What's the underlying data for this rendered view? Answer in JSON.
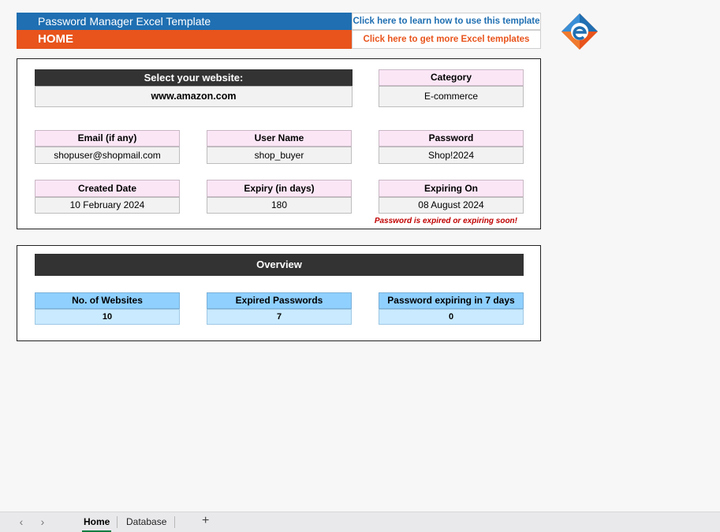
{
  "header": {
    "title": "Password Manager Excel Template",
    "subtitle": "HOME",
    "learn_link": "Click here to learn how to use this template",
    "more_link": "Click here to get more Excel templates"
  },
  "colors": {
    "brand_blue": "#1f6fb2",
    "brand_orange": "#e8541c",
    "warning_red": "#c00000"
  },
  "selection": {
    "select_label": "Select your website:",
    "website": "www.amazon.com",
    "category_label": "Category",
    "category_value": "E-commerce"
  },
  "credentials": {
    "email_label": "Email (if any)",
    "email_value": "shopuser@shopmail.com",
    "username_label": "User Name",
    "username_value": "shop_buyer",
    "password_label": "Password",
    "password_value": "Shop!2024"
  },
  "dates": {
    "created_label": "Created Date",
    "created_value": "10 February 2024",
    "expiry_label": "Expiry (in days)",
    "expiry_value": "180",
    "expiring_label": "Expiring On",
    "expiring_value": "08 August 2024",
    "warning": "Password is expired or expiring soon!"
  },
  "overview": {
    "title": "Overview",
    "websites_label": "No. of Websites",
    "websites_value": "10",
    "expired_label": "Expired Passwords",
    "expired_value": "7",
    "expiring7_label": "Password expiring in 7 days",
    "expiring7_value": "0"
  },
  "tabs": {
    "prev": "‹",
    "next": "›",
    "home": "Home",
    "database": "Database",
    "add": "+"
  }
}
